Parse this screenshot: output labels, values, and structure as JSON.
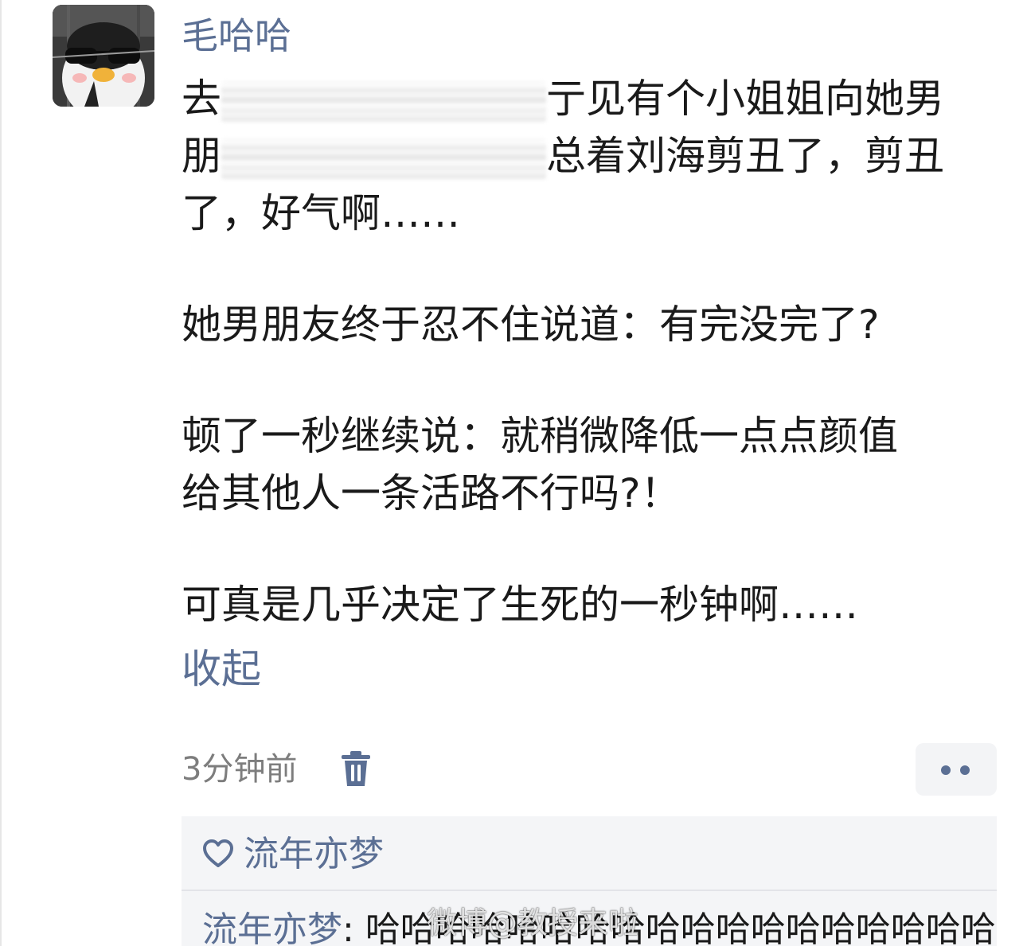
{
  "comment": {
    "username": "毛哈哈",
    "lines": {
      "l1_start": "去",
      "l1_end": "亍见有个小姐姐向她男",
      "l2_start": "朋",
      "l2_end": "总着刘海剪丑了，剪丑",
      "l3": "了，好气啊……"
    },
    "para2": "她男朋友终于忍不住说道：有完没完了?",
    "para3_line1": "顿了一秒继续说：就稍微降低一点点颜值",
    "para3_line2": "给其他人一条活路不行吗?！",
    "para4": "可真是几乎决定了生死的一秒钟啊……",
    "collapse_label": "收起",
    "timestamp": "3分钟前"
  },
  "likes": {
    "liker_name": "流年亦梦"
  },
  "reply": {
    "author": "流年亦梦",
    "separator": ": ",
    "text": "哈哈哈哈哈哈哈哈哈哈哈哈哈哈哈哈哈哈"
  },
  "watermark": "微博@教授来啦",
  "colors": {
    "link_blue": "#5b6f94",
    "text": "#1a1a1a",
    "muted": "#7d7d7d",
    "reply_bg": "#f4f5f7"
  },
  "icons": [
    "penguin-avatar",
    "trash-icon",
    "more-dots-icon",
    "heart-outline-icon"
  ]
}
